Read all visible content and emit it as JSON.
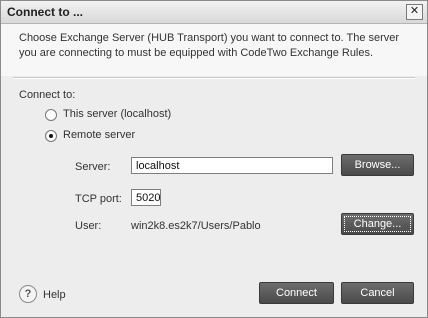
{
  "window": {
    "title": "Connect to ...",
    "close_glyph": "✕"
  },
  "description": "Choose Exchange Server (HUB Transport) you want to connect to. The server you are connecting to must be equipped with CodeTwo Exchange Rules.",
  "connect": {
    "label": "Connect to:",
    "option_local": "This server (localhost)",
    "option_remote": "Remote server",
    "selected": "Remote server"
  },
  "server": {
    "label": "Server:",
    "value": "localhost",
    "browse_label": "Browse..."
  },
  "tcp": {
    "label": "TCP port:",
    "value": "5020"
  },
  "user": {
    "label": "User:",
    "value": "win2k8.es2k7/Users/Pablo",
    "change_label": "Change..."
  },
  "footer": {
    "help_icon": "help-icon",
    "help_glyph": "?",
    "help_label": "Help",
    "connect_label": "Connect",
    "cancel_label": "Cancel"
  }
}
